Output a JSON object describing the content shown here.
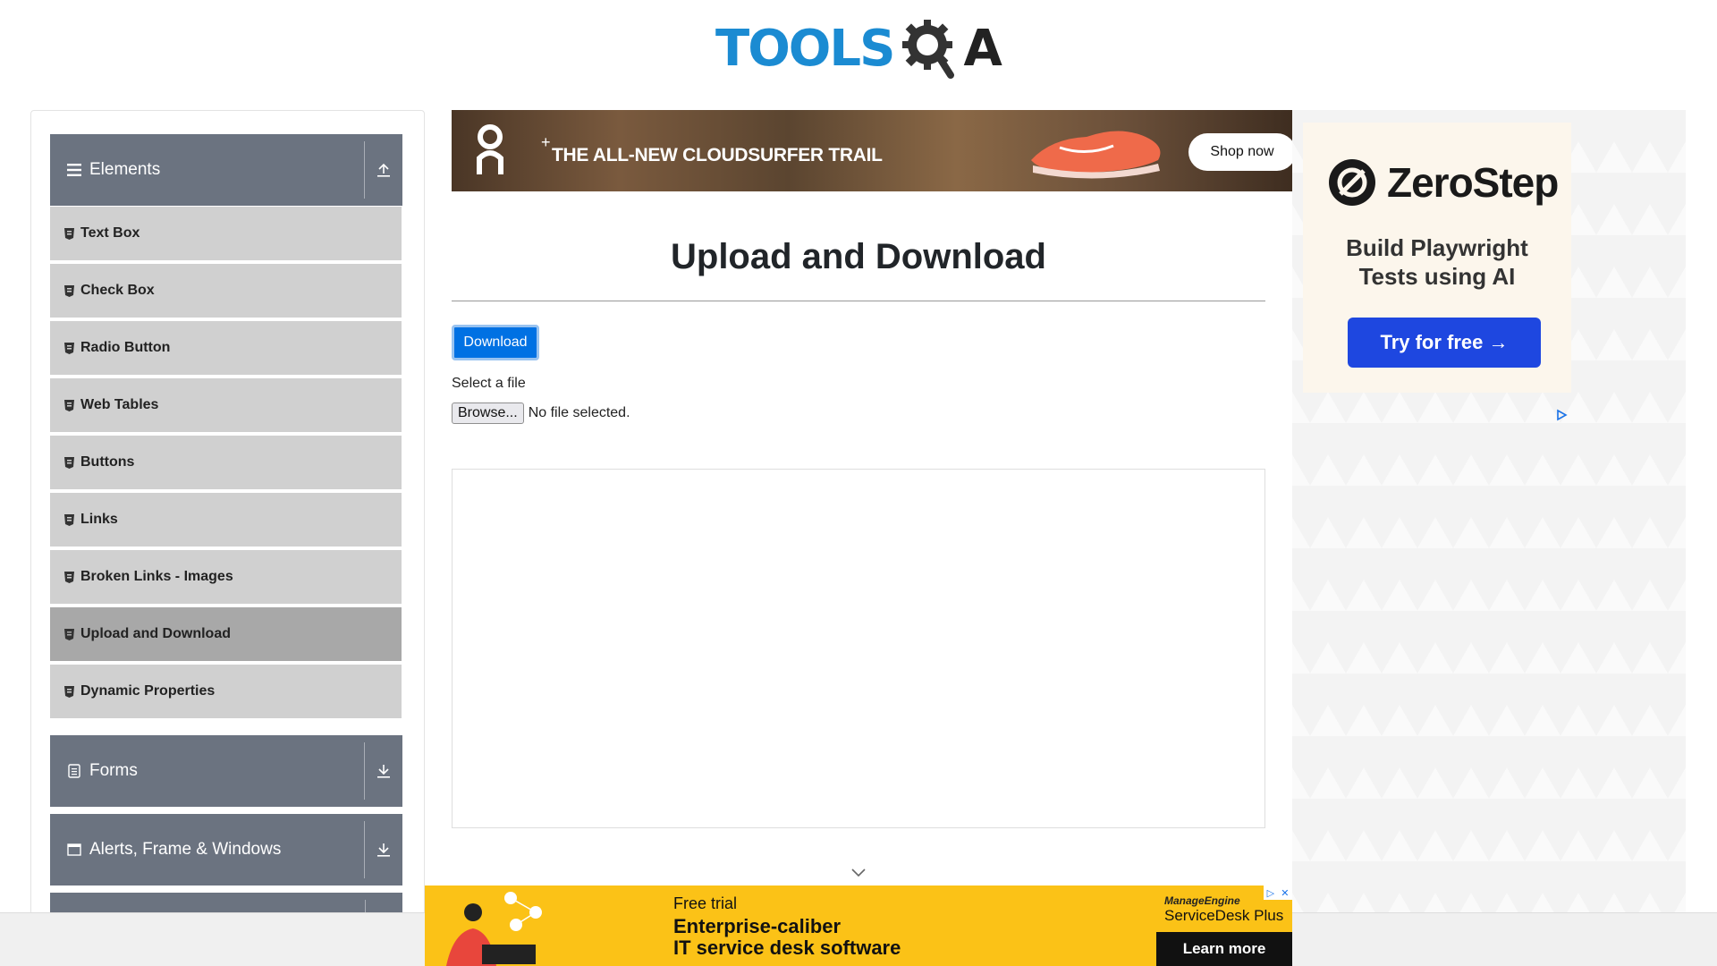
{
  "header": {
    "logo_text": "TOOLS",
    "logo_suffix": "A",
    "logo_alt": "TOOLSQA"
  },
  "sidebar": {
    "groups": [
      {
        "label": "Elements",
        "icon": "hamburger-icon",
        "toggle": "collapse-up-icon"
      },
      {
        "label": "Forms",
        "icon": "document-icon",
        "toggle": "expand-down-icon"
      },
      {
        "label": "Alerts, Frame & Windows",
        "icon": "window-icon",
        "toggle": "expand-down-icon"
      }
    ],
    "items": [
      {
        "label": "Text Box"
      },
      {
        "label": "Check Box"
      },
      {
        "label": "Radio Button"
      },
      {
        "label": "Web Tables"
      },
      {
        "label": "Buttons"
      },
      {
        "label": "Links"
      },
      {
        "label": "Broken Links - Images"
      },
      {
        "label": "Upload and Download",
        "active": true
      },
      {
        "label": "Dynamic Properties"
      }
    ]
  },
  "top_ad": {
    "headline": "THE ALL-NEW CLOUDSURFER TRAIL",
    "plus": "+",
    "button": "Shop now"
  },
  "main": {
    "title": "Upload and Download",
    "download_label": "Download",
    "file_label": "Select a file",
    "browse_label": "Browse...",
    "file_status": "No file selected."
  },
  "right_ad": {
    "brand": "ZeroStep",
    "tagline_1": "Build Playwright",
    "tagline_2": "Tests using AI",
    "button": "Try for free →"
  },
  "bottom_ad": {
    "line1": "Free trial",
    "line2": "Enterprise-caliber",
    "line3": "IT service desk software",
    "brand_1": "ManageEngine",
    "brand_2": "ServiceDesk Plus",
    "button": "Learn more"
  },
  "colors": {
    "accent": "#0071e3",
    "sidebar_header": "#6b7380",
    "sidebar_item": "#d0d0d0",
    "sidebar_active": "#a8a8a8",
    "logo_blue": "#1b8bd2",
    "zerostep_button": "#1e47e0",
    "bottom_ad_bg": "#fbc217"
  }
}
